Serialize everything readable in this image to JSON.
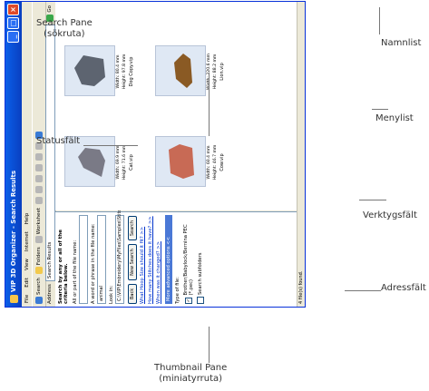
{
  "window": {
    "title": "VIP 3D Organizer - Search Results"
  },
  "menu": [
    "File",
    "Edit",
    "View",
    "Internet",
    "Help"
  ],
  "toolbar": {
    "search": "Search",
    "folders": "Folders",
    "worksheet": "Worksheet"
  },
  "address": {
    "label": "Address",
    "value": "Search Results",
    "go": "Go"
  },
  "search_pane": {
    "title": "Search by any or all of the criteria below.",
    "name_label": "All or part of the file name:",
    "name_value": "",
    "word_label": "A word or phrase in the file name:",
    "word_value": "animal",
    "lookin_label": "Look in:",
    "lookin_value": "C:\\VIP\\Embroidery\\MyFiles\\Samples\\Stitch",
    "back": "Back",
    "new_search": "New Search",
    "search": "Search",
    "link1": "What Hoop Size should it fit? >>",
    "link2": "How many Stitches does it have? >>",
    "link3": "When was it changed? >>",
    "more": "More advanced options <<",
    "type_label": "Type of file:",
    "type_value": "Brother/Babylock/Bernina PEC (*.pec)",
    "check_label": "Search subfolders"
  },
  "thumbnails": [
    {
      "caption": "Cat.vip",
      "width": "Width: 69.9 mm",
      "height": "Height: 71.6 mm"
    },
    {
      "caption": "Cow.vip",
      "width": "Width: 60.4 mm",
      "height": "Height: 46.7 mm"
    },
    {
      "caption": "Dog Copy.vip",
      "width": "Width: 80.4 mm",
      "height": "Height: 97.8 mm"
    },
    {
      "caption": "Lion.vip",
      "width": "Width: 220.6 mm",
      "height": "Height: 88.2 mm"
    }
  ],
  "status": "4 file(s) found.",
  "callouts": {
    "namnlist": "Namnlist",
    "menylist": "Menylist",
    "verktygsfalt": "Verktygsfält",
    "adressfalt": "Adressfält",
    "search_pane": "Search Pane",
    "search_pane_sub": "(sökruta)",
    "statusfalt": "Statusfält",
    "thumbnail_pane": "Thumbnail Pane",
    "thumbnail_pane_sub": "(miniatyrruta)"
  }
}
